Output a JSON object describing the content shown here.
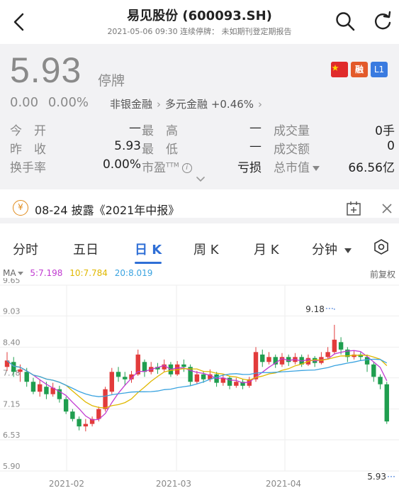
{
  "header": {
    "title": "易见股份 (600093.SH)",
    "subtitle": "2021-05-06 09:30 连续停牌： 未如期刊登定期报告"
  },
  "quote": {
    "price": "5.93",
    "status": "停牌",
    "change": "0.00",
    "change_pct": "0.00%",
    "sector1": "非银金融",
    "sector2": "多元金融",
    "sector2_change": "+0.46%",
    "badges": {
      "rong": "融",
      "l1": "L1"
    }
  },
  "stats": [
    [
      {
        "label": "今　开",
        "value": "—"
      },
      {
        "label": "最　高",
        "value": "—"
      },
      {
        "label": "成交量",
        "value": "0手"
      }
    ],
    [
      {
        "label": "昨　收",
        "value": "5.93"
      },
      {
        "label": "最　低",
        "value": "—"
      },
      {
        "label": "成交额",
        "value": "0"
      }
    ],
    [
      {
        "label": "换手率",
        "value": "0.00%"
      },
      {
        "label": "市盈",
        "sup": "TTM",
        "value": "亏损"
      },
      {
        "label": "总市值",
        "value": "66.56亿"
      }
    ]
  ],
  "notice": {
    "icon_text": "¥",
    "text": "08-24 披露《2021年中报》"
  },
  "tabs": [
    "分时",
    "五日",
    "日 K",
    "周 K",
    "月 K",
    "分钟"
  ],
  "active_tab": 2,
  "indicators": {
    "ma_label": "MA",
    "ma5": "5:7.198",
    "ma10": "10:7.784",
    "ma20": "20:8.019",
    "adjust": "前复权"
  },
  "colors": {
    "up": "#e23b3b",
    "down": "#1f9e4f",
    "ma5": "#c13bd1",
    "ma10": "#e0b800",
    "ma20": "#3aa3e0",
    "accent": "#2f6fd6"
  },
  "chart_data": {
    "type": "candlestick",
    "y_ticks": [
      "9.65",
      "9.03",
      "8.40",
      "7.78",
      "7.15",
      "6.53",
      "5.90"
    ],
    "ylim": [
      5.9,
      9.65
    ],
    "x_ticks": [
      "2021-02",
      "2021-03",
      "2021-04"
    ],
    "annotations": {
      "max": "9.18",
      "min": "5.93"
    },
    "candles": [
      [
        8.0,
        8.13,
        8.3,
        7.92
      ],
      [
        8.1,
        7.9,
        8.2,
        7.8
      ],
      [
        7.9,
        7.95,
        8.05,
        7.7
      ],
      [
        7.9,
        7.7,
        7.98,
        7.6
      ],
      [
        7.7,
        7.5,
        7.78,
        7.45
      ],
      [
        7.5,
        7.65,
        7.75,
        7.4
      ],
      [
        7.6,
        7.45,
        7.7,
        7.35
      ],
      [
        7.45,
        7.58,
        7.68,
        7.4
      ],
      [
        7.55,
        7.35,
        7.62,
        7.28
      ],
      [
        7.35,
        7.1,
        7.4,
        7.05
      ],
      [
        7.1,
        6.95,
        7.15,
        6.9
      ],
      [
        6.95,
        6.8,
        7.0,
        6.72
      ],
      [
        6.8,
        6.85,
        6.95,
        6.7
      ],
      [
        6.85,
        6.95,
        7.0,
        6.8
      ],
      [
        6.95,
        7.15,
        7.2,
        6.9
      ],
      [
        7.15,
        7.55,
        7.6,
        7.1
      ],
      [
        7.5,
        7.9,
        7.98,
        7.45
      ],
      [
        7.9,
        7.8,
        8.0,
        7.7
      ],
      [
        7.8,
        7.75,
        7.9,
        7.62
      ],
      [
        7.75,
        7.85,
        7.92,
        7.68
      ],
      [
        7.85,
        8.25,
        8.35,
        7.82
      ],
      [
        8.1,
        7.9,
        8.15,
        7.8
      ],
      [
        7.9,
        8.0,
        8.1,
        7.85
      ],
      [
        8.0,
        7.95,
        8.08,
        7.86
      ],
      [
        7.95,
        8.05,
        8.15,
        7.9
      ],
      [
        8.05,
        7.85,
        8.1,
        7.8
      ],
      [
        7.85,
        8.05,
        8.12,
        7.82
      ],
      [
        8.05,
        8.0,
        8.15,
        7.9
      ],
      [
        8.0,
        7.7,
        8.05,
        7.62
      ],
      [
        7.7,
        7.85,
        7.92,
        7.65
      ],
      [
        7.85,
        7.75,
        7.92,
        7.68
      ],
      [
        7.75,
        7.85,
        7.95,
        7.7
      ],
      [
        7.85,
        7.68,
        7.9,
        7.6
      ],
      [
        7.68,
        7.78,
        7.85,
        7.62
      ],
      [
        7.78,
        7.62,
        7.82,
        7.55
      ],
      [
        7.62,
        7.7,
        7.78,
        7.58
      ],
      [
        7.7,
        7.62,
        7.75,
        7.55
      ],
      [
        7.62,
        7.75,
        7.8,
        7.58
      ],
      [
        7.75,
        8.3,
        8.4,
        7.7
      ],
      [
        8.25,
        8.1,
        8.35,
        8.0
      ],
      [
        8.1,
        8.2,
        8.3,
        8.05
      ],
      [
        8.2,
        8.05,
        8.25,
        7.98
      ],
      [
        8.05,
        8.2,
        8.28,
        8.0
      ],
      [
        8.2,
        8.1,
        8.25,
        8.02
      ],
      [
        8.1,
        8.2,
        8.28,
        8.05
      ],
      [
        8.2,
        8.05,
        8.25,
        8.0
      ],
      [
        8.05,
        8.18,
        8.25,
        8.02
      ],
      [
        8.18,
        8.08,
        8.22,
        8.0
      ],
      [
        8.08,
        8.2,
        8.3,
        8.05
      ],
      [
        8.2,
        8.3,
        8.4,
        8.15
      ],
      [
        8.3,
        8.55,
        8.85,
        8.25
      ],
      [
        8.5,
        8.35,
        8.6,
        8.25
      ],
      [
        8.35,
        8.2,
        8.4,
        8.1
      ],
      [
        8.2,
        8.25,
        8.32,
        8.15
      ],
      [
        8.25,
        8.2,
        8.3,
        8.12
      ],
      [
        8.2,
        8.05,
        8.25,
        7.9
      ],
      [
        8.05,
        7.8,
        8.1,
        7.7
      ],
      [
        7.8,
        7.65,
        7.85,
        7.55
      ],
      [
        7.65,
        6.9,
        7.7,
        6.85
      ],
      [
        5.93,
        5.93,
        5.93,
        5.93
      ]
    ]
  }
}
